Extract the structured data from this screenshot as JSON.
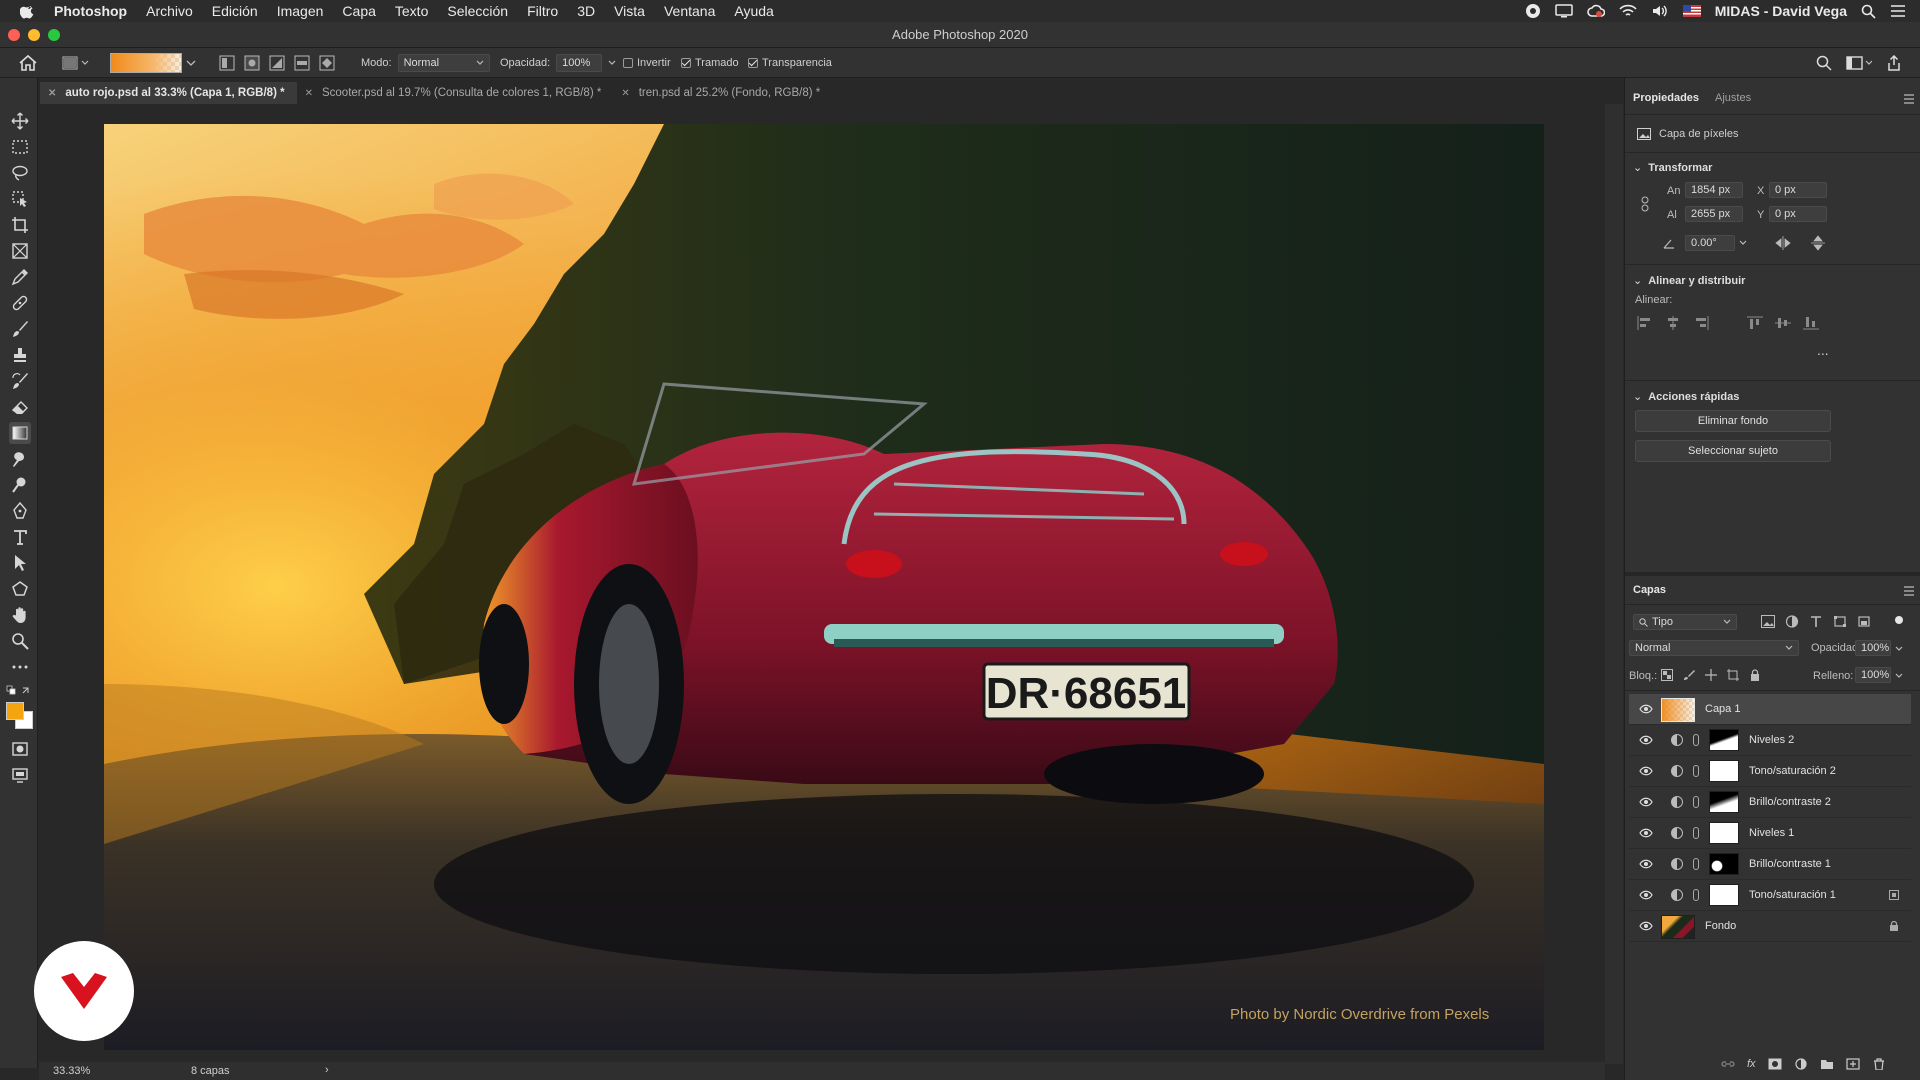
{
  "menubar": {
    "app_name": "Photoshop",
    "items": [
      "Archivo",
      "Edición",
      "Imagen",
      "Capa",
      "Texto",
      "Selección",
      "Filtro",
      "3D",
      "Vista",
      "Ventana",
      "Ayuda"
    ],
    "user": "MIDAS - David Vega"
  },
  "window": {
    "title": "Adobe Photoshop 2020"
  },
  "options": {
    "mode_label": "Modo:",
    "mode_value": "Normal",
    "opacity_label": "Opacidad:",
    "opacity_value": "100%",
    "invert_label": "Invertir",
    "dither_label": "Tramado",
    "transparency_label": "Transparencia",
    "gradient_colors": [
      "#f08a1a",
      "#f7c98a"
    ]
  },
  "tabs": [
    {
      "label": "auto rojo.psd al 33.3% (Capa 1, RGB/8) *",
      "active": true
    },
    {
      "label": "Scooter.psd al 19.7% (Consulta de colores 1, RGB/8) *",
      "active": false
    },
    {
      "label": "tren.psd al 25.2% (Fondo, RGB/8) *",
      "active": false
    }
  ],
  "canvas": {
    "credit": "Photo by Nordic Overdrive from Pexels",
    "plate": "DR·68651"
  },
  "statusbar": {
    "zoom": "33.33%",
    "info": "8 capas"
  },
  "properties": {
    "tab_active": "Propiedades",
    "tab_other": "Ajustes",
    "layer_type": "Capa de píxeles",
    "transform": {
      "heading": "Transformar",
      "w_label": "An",
      "w_value": "1854 px",
      "h_label": "Al",
      "h_value": "2655 px",
      "x_label": "X",
      "x_value": "0 px",
      "y_label": "Y",
      "y_value": "0 px",
      "angle_value": "0.00°"
    },
    "align": {
      "heading": "Alinear y distribuir",
      "sub": "Alinear:",
      "more": "..."
    },
    "quick": {
      "heading": "Acciones rápidas",
      "btn_remove_bg": "Eliminar fondo",
      "btn_select_subject": "Seleccionar sujeto"
    }
  },
  "layers_panel": {
    "title": "Capas",
    "filter_value": "Tipo",
    "blend_value": "Normal",
    "opacity_label": "Opacidad:",
    "opacity_value": "100%",
    "lock_label": "Bloq.:",
    "fill_label": "Relleno:",
    "fill_value": "100%",
    "layers": [
      {
        "name": "Capa 1",
        "kind": "pixel",
        "selected": true
      },
      {
        "name": "Niveles 2",
        "kind": "adjustment",
        "mask": "gradient"
      },
      {
        "name": "Tono/saturación 2",
        "kind": "adjustment",
        "mask": "white"
      },
      {
        "name": "Brillo/contraste 2",
        "kind": "adjustment",
        "mask": "gradient"
      },
      {
        "name": "Niveles 1",
        "kind": "adjustment",
        "mask": "white"
      },
      {
        "name": "Brillo/contraste 1",
        "kind": "adjustment",
        "mask": "black"
      },
      {
        "name": "Tono/saturación 1",
        "kind": "adjustment",
        "mask": "white"
      },
      {
        "name": "Fondo",
        "kind": "background",
        "locked": true
      }
    ]
  }
}
